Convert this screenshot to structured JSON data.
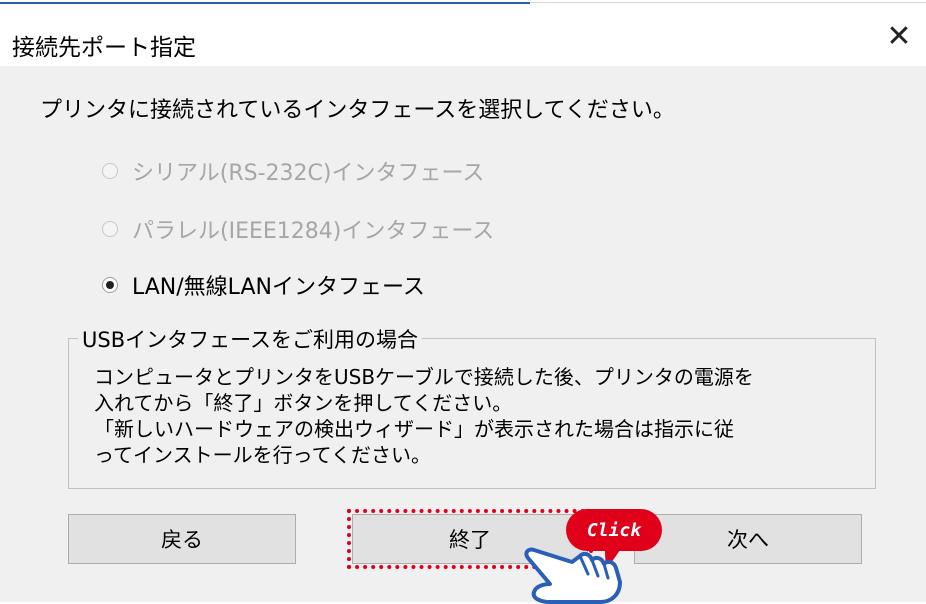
{
  "window": {
    "title": "接続先ポート指定",
    "close_symbol": "✕"
  },
  "prompt": "プリンタに接続されているインタフェースを選択してください。",
  "options": [
    {
      "label": "シリアル(RS-232C)インタフェース",
      "enabled": false,
      "selected": false
    },
    {
      "label": "パラレル(IEEE1284)インタフェース",
      "enabled": false,
      "selected": false
    },
    {
      "label": "LAN/無線LANインタフェース",
      "enabled": true,
      "selected": true
    }
  ],
  "usb_group": {
    "legend": "USBインタフェースをご利用の場合",
    "line1": "コンピュータとプリンタをUSBケーブルで接続した後、プリンタの電源を",
    "line2": "入れてから「終了」ボタンを押してください。",
    "line3": "「新しいハードウェアの検出ウィザード」が表示された場合は指示に従",
    "line4": "ってインストールを行ってください。"
  },
  "buttons": {
    "back": "戻る",
    "finish": "終了",
    "next": "次へ"
  },
  "annotation": {
    "click_label": "Click",
    "accent_color": "#e0001a"
  }
}
